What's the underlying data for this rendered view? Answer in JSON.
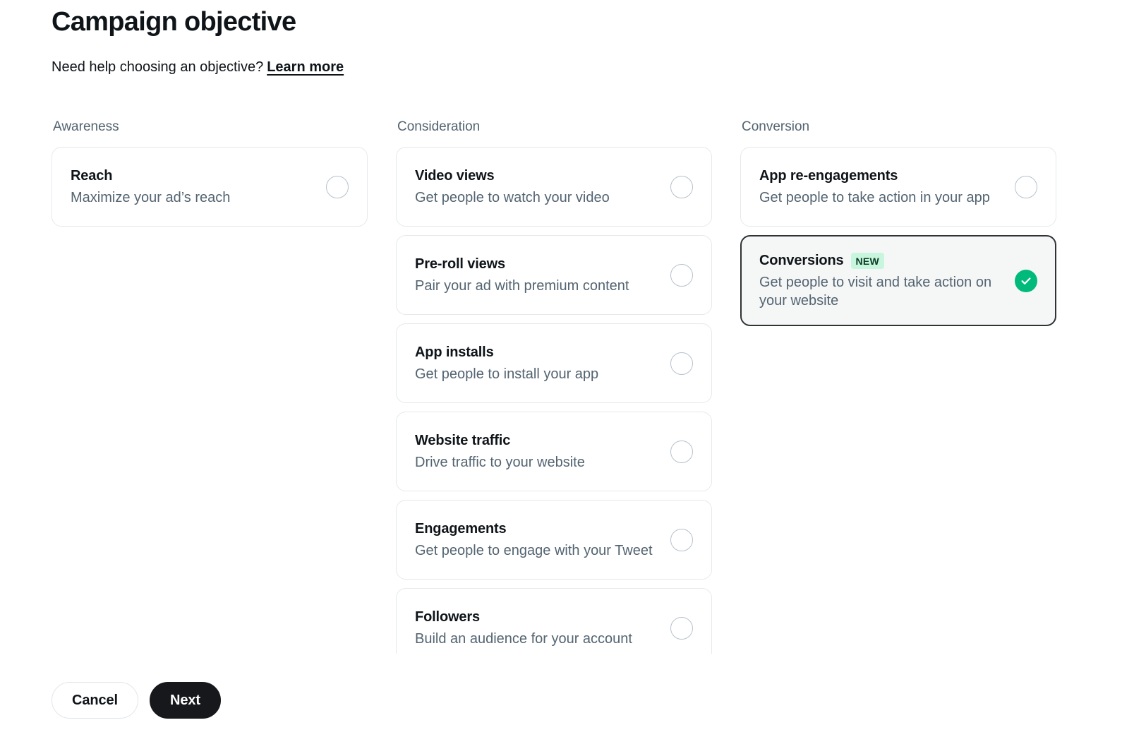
{
  "header": {
    "title": "Campaign objective",
    "help_text": "Need help choosing an objective?",
    "learn_more_label": "Learn more"
  },
  "columns": [
    {
      "heading": "Awareness",
      "cards": [
        {
          "title": "Reach",
          "description": "Maximize your ad’s reach",
          "badge": "",
          "selected": false,
          "control": "radio-unselected"
        }
      ]
    },
    {
      "heading": "Consideration",
      "cards": [
        {
          "title": "Video views",
          "description": "Get people to watch your video",
          "badge": "",
          "selected": false,
          "control": "radio-unselected"
        },
        {
          "title": "Pre-roll views",
          "description": "Pair your ad with premium content",
          "badge": "",
          "selected": false,
          "control": "radio-unselected"
        },
        {
          "title": "App installs",
          "description": "Get people to install your app",
          "badge": "",
          "selected": false,
          "control": "radio-unselected"
        },
        {
          "title": "Website traffic",
          "description": "Drive traffic to your website",
          "badge": "",
          "selected": false,
          "control": "radio-unselected"
        },
        {
          "title": "Engagements",
          "description": "Get people to engage with your Tweet",
          "badge": "",
          "selected": false,
          "control": "radio-unselected"
        },
        {
          "title": "Followers",
          "description": "Build an audience for your account",
          "badge": "",
          "selected": false,
          "control": "radio-unselected"
        }
      ]
    },
    {
      "heading": "Conversion",
      "cards": [
        {
          "title": "App re-engagements",
          "description": "Get people to take action in your app",
          "badge": "",
          "selected": false,
          "control": "radio-unselected"
        },
        {
          "title": "Conversions",
          "description": "Get people to visit and take action on your website",
          "badge": "NEW",
          "selected": true,
          "control": "check-selected"
        }
      ]
    }
  ],
  "footer": {
    "cancel_label": "Cancel",
    "next_label": "Next"
  },
  "colors": {
    "text_primary": "#0f1419",
    "text_secondary": "#536471",
    "card_border": "#e6e9ea",
    "selected_border": "#2f3336",
    "selected_background": "#f5f6f6",
    "badge_background": "#c8f5dd",
    "badge_text": "#0b3b24",
    "check_green": "#00ba7c",
    "next_button_background": "#16181c",
    "radio_border": "#b6c2cc"
  }
}
